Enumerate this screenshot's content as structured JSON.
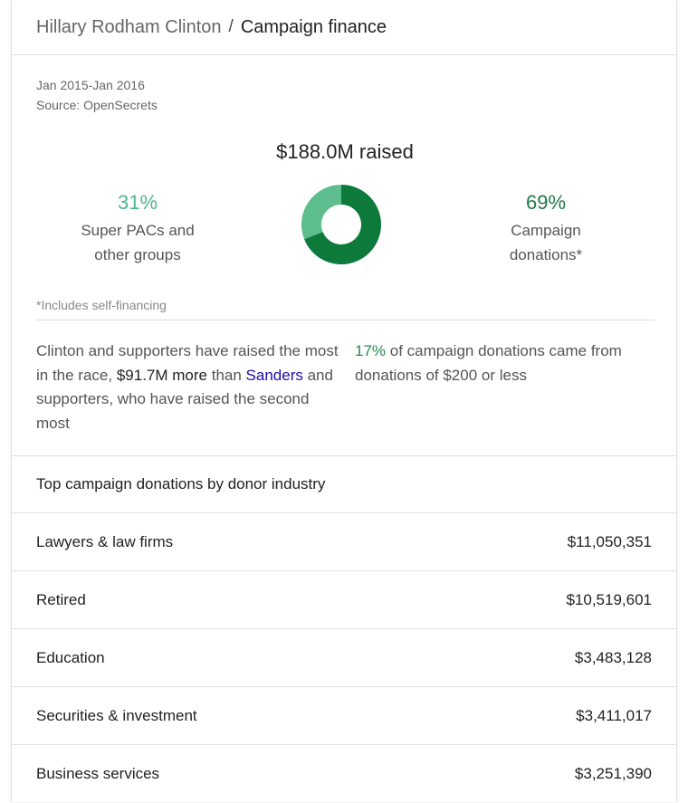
{
  "header": {
    "breadcrumb_link": "Hillary Rodham Clinton",
    "separator": "/",
    "current": "Campaign finance"
  },
  "meta": {
    "date_range": "Jan 2015-Jan 2016",
    "source": "Source: OpenSecrets"
  },
  "total_raised": "$188.0M raised",
  "breakdown": {
    "left": {
      "pct": "31%",
      "label_line1": "Super PACs and",
      "label_line2": "other groups"
    },
    "right": {
      "pct": "69%",
      "label_line1": "Campaign",
      "label_line2": "donations*"
    }
  },
  "chart_data": {
    "type": "pie",
    "categories": [
      "Super PACs and other groups",
      "Campaign donations*"
    ],
    "values": [
      31,
      69
    ],
    "colors": [
      "#5dbd8d",
      "#0d7a3c"
    ],
    "title": "",
    "donut": true
  },
  "footnote": "*Includes self-financing",
  "summary": {
    "left_part1": "Clinton and supporters have raised the most in the race, ",
    "left_em": "$91.7M more",
    "left_part2": " than ",
    "left_link": "Sanders",
    "left_part3": " and supporters, who have raised the second most",
    "right_pct": "17%",
    "right_text": " of campaign donations came from donations of $200 or less"
  },
  "industry": {
    "title": "Top campaign donations by donor industry",
    "rows": [
      {
        "name": "Lawyers & law firms",
        "amount": "$11,050,351"
      },
      {
        "name": "Retired",
        "amount": "$10,519,601"
      },
      {
        "name": "Education",
        "amount": "$3,483,128"
      },
      {
        "name": "Securities & investment",
        "amount": "$3,411,017"
      },
      {
        "name": "Business services",
        "amount": "$3,251,390"
      }
    ]
  }
}
